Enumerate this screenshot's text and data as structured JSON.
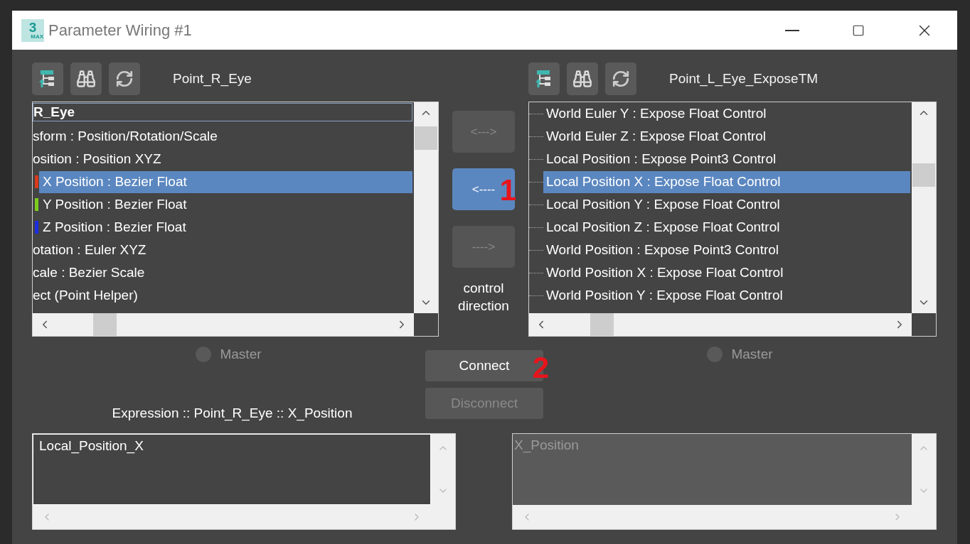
{
  "window": {
    "title": "Parameter Wiring #1",
    "app_icon": {
      "digit": "3",
      "caption": "MAX"
    }
  },
  "left_panel": {
    "object_name": "Point_R_Eye",
    "tree": [
      {
        "kind": "root",
        "label": "R_Eye",
        "selected": false
      },
      {
        "kind": "item",
        "label": "sform : Position/Rotation/Scale",
        "selected": false
      },
      {
        "kind": "item",
        "label": "osition : Position XYZ",
        "selected": false
      },
      {
        "kind": "track",
        "label": "X Position : Bezier Float",
        "selected": true,
        "color": "#d83a1c"
      },
      {
        "kind": "track",
        "label": "Y Position : Bezier Float",
        "selected": false,
        "color": "#7ccc1c"
      },
      {
        "kind": "track",
        "label": "Z Position : Bezier Float",
        "selected": false,
        "color": "#1c2ce0"
      },
      {
        "kind": "item",
        "label": "otation : Euler XYZ",
        "selected": false
      },
      {
        "kind": "item",
        "label": "cale : Bezier Scale",
        "selected": false
      },
      {
        "kind": "item",
        "label": "ect (Point Helper)",
        "selected": false
      }
    ],
    "master": {
      "label": "Master",
      "checked": false
    }
  },
  "direction_buttons": [
    {
      "label": "<--->",
      "selected": false
    },
    {
      "label": "<----",
      "selected": true,
      "annotation": "1"
    },
    {
      "label": "---->",
      "selected": false
    }
  ],
  "direction_caption": "control direction",
  "right_panel": {
    "object_name": "Point_L_Eye_ExposeTM",
    "tree": [
      {
        "kind": "item",
        "label": "World Euler Y : Expose Float Control",
        "selected": false
      },
      {
        "kind": "item",
        "label": "World Euler Z : Expose Float Control",
        "selected": false
      },
      {
        "kind": "item",
        "label": "Local Position : Expose Point3 Control",
        "selected": false
      },
      {
        "kind": "item",
        "label": "Local Position X : Expose Float Control",
        "selected": true
      },
      {
        "kind": "item",
        "label": "Local Position Y : Expose Float Control",
        "selected": false
      },
      {
        "kind": "item",
        "label": "Local Position Z : Expose Float Control",
        "selected": false
      },
      {
        "kind": "item",
        "label": "World Position : Expose Point3 Control",
        "selected": false
      },
      {
        "kind": "item",
        "label": "World Position X : Expose Float Control",
        "selected": false
      },
      {
        "kind": "item",
        "label": "World Position Y : Expose Float Control",
        "selected": false
      }
    ],
    "master": {
      "label": "Master",
      "checked": false
    }
  },
  "actions": [
    {
      "label": "Connect",
      "disabled": false,
      "annotation": "2"
    },
    {
      "label": "Disconnect",
      "disabled": true
    }
  ],
  "expression_label": "Expression :: Point_R_Eye :: X_Position",
  "expressions": [
    {
      "value": "Local_Position_X",
      "disabled": false
    },
    {
      "value": "X_Position",
      "disabled": true
    }
  ]
}
